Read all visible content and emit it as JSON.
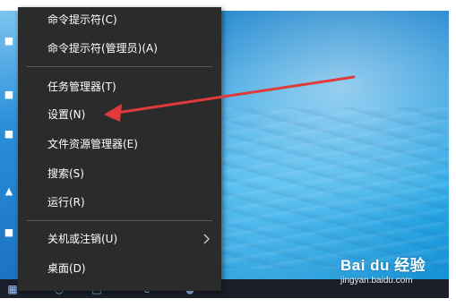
{
  "menu": {
    "items": [
      {
        "label": "命令提示符(C)"
      },
      {
        "label": "命令提示符(管理员)(A)"
      },
      {
        "label": "任务管理器(T)"
      },
      {
        "label": "设置(N)"
      },
      {
        "label": "文件资源管理器(E)"
      },
      {
        "label": "搜索(S)"
      },
      {
        "label": "运行(R)"
      },
      {
        "label": "关机或注销(U)"
      },
      {
        "label": "桌面(D)"
      }
    ],
    "submenu_icon": "chevron-right-icon"
  },
  "annotation": {
    "color": "#e03a3a",
    "target": "设置(N)"
  },
  "watermark": {
    "logo": "Bai du 经验",
    "url": "jingyan.baidu.com"
  },
  "colors": {
    "menu_bg": "#2b2b2b",
    "menu_text": "#ffffff",
    "taskbar": "#1a1f2a"
  }
}
